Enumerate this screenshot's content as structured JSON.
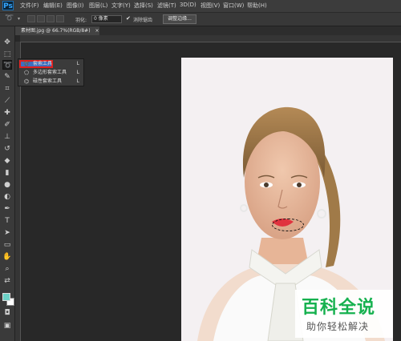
{
  "app": {
    "logo": "Ps"
  },
  "menu": [
    "文件(F)",
    "编辑(E)",
    "图像(I)",
    "图层(L)",
    "文字(Y)",
    "选择(S)",
    "滤镜(T)",
    "3D(D)",
    "视图(V)",
    "窗口(W)",
    "帮助(H)"
  ],
  "options": {
    "feather_label": "羽化:",
    "feather_value": "0 像素",
    "antialias_label": "消除锯齿",
    "antialias_checked": true,
    "refine_button": "调整边缘..."
  },
  "document_tab": {
    "title": "素材图.jpg @ 66.7%(RGB/8#)",
    "close": "×"
  },
  "flyout": [
    {
      "label": "套索工具",
      "shortcut": "L",
      "icon": "lasso-icon",
      "selected": true
    },
    {
      "label": "多边形套索工具",
      "shortcut": "L",
      "icon": "polygonal-lasso-icon",
      "selected": false
    },
    {
      "label": "磁性套索工具",
      "shortcut": "L",
      "icon": "magnetic-lasso-icon",
      "selected": false
    }
  ],
  "swatches": {
    "foreground": "#6cd2c7",
    "background": "#ffffff"
  },
  "watermark": {
    "title": "百科全说",
    "subtitle": "助你轻松解决",
    "color": "#16b14f"
  }
}
